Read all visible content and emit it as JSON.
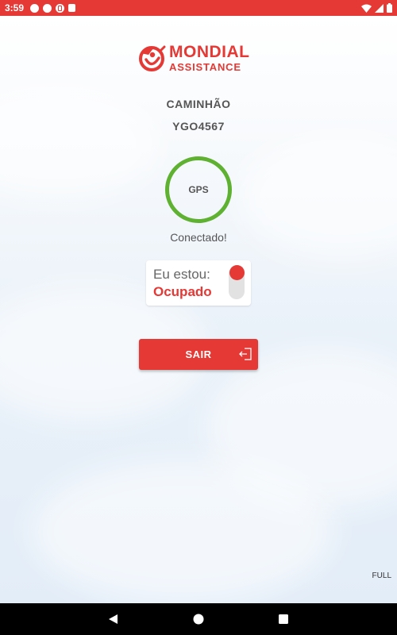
{
  "status_bar": {
    "time": "3:59",
    "color": "#e53935"
  },
  "logo": {
    "title": "MONDIAL",
    "subtitle": "ASSISTANCE",
    "color": "#e53935"
  },
  "vehicle": {
    "type": "CAMINHÃO",
    "plate": "YGO4567"
  },
  "gps": {
    "label": "GPS",
    "status": "Conectado!",
    "ring_color": "#5fb131"
  },
  "availability": {
    "prefix": "Eu estou:",
    "value": "Ocupado",
    "toggle_on": false,
    "value_color": "#e53935"
  },
  "exit_button": {
    "label": "SAIR",
    "icon": "exit-icon"
  },
  "footer": {
    "mode_label": "FULL"
  },
  "nav": {
    "back_icon": "back-triangle-icon",
    "home_icon": "home-circle-icon",
    "recent_icon": "recent-apps-square-icon"
  }
}
